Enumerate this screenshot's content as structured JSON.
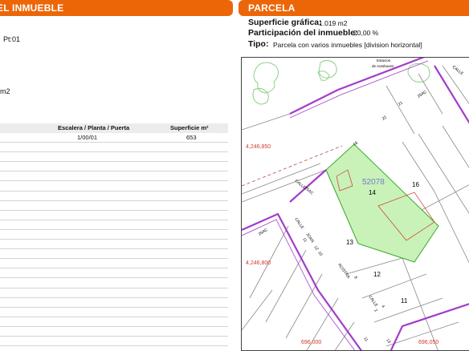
{
  "left_header": {
    "title": "EL INMUEBLE"
  },
  "left_fragments": {
    "location": "Pt:01",
    "area_unit": "m2"
  },
  "table": {
    "headers": [
      "Escalera / Planta / Puerta",
      "Superficie m²"
    ],
    "rows": [
      [
        "1/00/01",
        "653"
      ],
      [
        "",
        ""
      ],
      [
        "",
        ""
      ],
      [
        "",
        ""
      ],
      [
        "",
        ""
      ],
      [
        "",
        ""
      ],
      [
        "",
        ""
      ],
      [
        "",
        ""
      ],
      [
        "",
        ""
      ],
      [
        "",
        ""
      ],
      [
        "",
        ""
      ],
      [
        "",
        ""
      ],
      [
        "",
        ""
      ],
      [
        "",
        ""
      ],
      [
        "",
        ""
      ],
      [
        "",
        ""
      ],
      [
        "",
        ""
      ],
      [
        "",
        ""
      ],
      [
        "",
        ""
      ],
      [
        "",
        ""
      ],
      [
        "",
        ""
      ],
      [
        "",
        ""
      ]
    ]
  },
  "right_header": {
    "title": "PARCELA"
  },
  "parcel_info": {
    "superficie_label": "Superficie gráfica:",
    "superficie_value": "1.019 m2",
    "participacion_label": "Participación del inmueble:",
    "participacion_value": "20,00 %",
    "tipo_label": "Tipo:",
    "tipo_value": "Parcela con varios inmuebles [division horizontal]"
  },
  "map": {
    "station_line1": "Estacion",
    "station_line2": "de Autobuses",
    "coord_y_top": "4,246,850",
    "coord_y_bottom": "4,246,800",
    "coord_x_left": "696,000",
    "coord_x_right": "696,050",
    "parcel_ref": "52078",
    "plot_numbers": [
      "14",
      "16",
      "13",
      "12",
      "11"
    ],
    "street_labels": [
      "CALLE",
      "25AC",
      "21",
      "22",
      "18",
      "CALLE",
      "25AC",
      "CALLE",
      "JOAN",
      "11",
      "12",
      "10",
      "ACISTRA",
      "8",
      "CALLE",
      "4",
      "2",
      "25AC",
      "11",
      "13"
    ],
    "colors": {
      "street": "#a23dc9",
      "parcel_fill": "#c8f2b8",
      "parcel_edge": "#3aa82d",
      "coord": "#d23a2a",
      "ref": "#7777cc",
      "trees": "#8fd08a"
    }
  }
}
